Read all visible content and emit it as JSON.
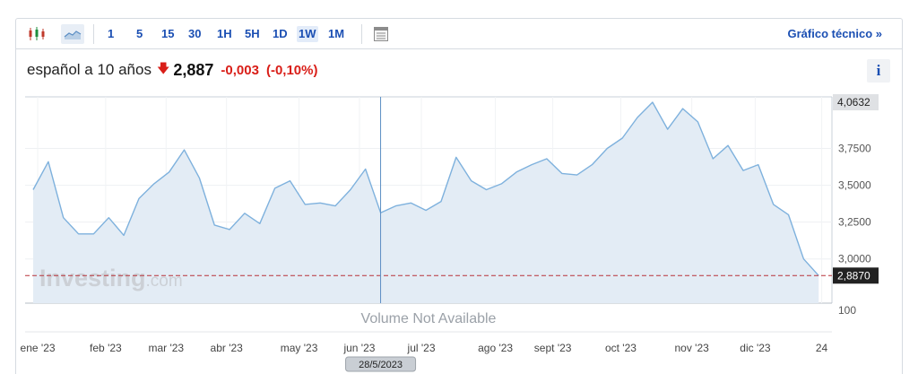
{
  "toolbar": {
    "intervals": [
      "1",
      "5",
      "15",
      "30",
      "1H",
      "5H",
      "1D",
      "1W",
      "1M"
    ],
    "active_interval": "1W",
    "technical_link": "Gráfico técnico »"
  },
  "quote": {
    "name": "español a 10 años",
    "direction": "down",
    "price": "2,887",
    "change": "-0,003",
    "change_pct": "(-0,10%)",
    "negative_color": "#d91e18"
  },
  "info_label": "i",
  "watermark": {
    "brand": "Investing",
    "suffix": ".com"
  },
  "volume_text": "Volume Not Available",
  "volume_axis_label": "100",
  "crosshair_date": "28/5/2023",
  "chart_data": {
    "type": "area",
    "color": "#7eb1dd",
    "fill": "#e3ecf5",
    "last_value": 2.887,
    "last_value_label": "2,8870",
    "max_value": 4.0632,
    "max_value_label": "4,0632",
    "crosshair_value": 3.313,
    "ylim": [
      2.7,
      4.1
    ],
    "y_ticks": [
      3.0,
      3.25,
      3.5,
      3.75
    ],
    "y_tick_labels": [
      "3,0000",
      "3,2500",
      "3,5000",
      "3,7500"
    ],
    "x_tick_labels": [
      "ene '23",
      "feb '23",
      "mar '23",
      "abr '23",
      "may '23",
      "jun '23",
      "jul '23",
      "ago '23",
      "sept '23",
      "oct '23",
      "nov '23",
      "dic '23",
      "24"
    ],
    "x_tick_index": [
      0.3,
      4.8,
      8.8,
      12.8,
      17.6,
      21.6,
      25.7,
      30.6,
      34.4,
      38.9,
      43.6,
      47.8,
      52.2
    ],
    "values": [
      3.47,
      3.66,
      3.28,
      3.17,
      3.17,
      3.28,
      3.16,
      3.41,
      3.51,
      3.59,
      3.74,
      3.55,
      3.23,
      3.2,
      3.31,
      3.24,
      3.48,
      3.53,
      3.37,
      3.38,
      3.36,
      3.47,
      3.61,
      3.313,
      3.36,
      3.38,
      3.33,
      3.39,
      3.69,
      3.53,
      3.47,
      3.51,
      3.59,
      3.64,
      3.68,
      3.58,
      3.57,
      3.64,
      3.75,
      3.82,
      3.96,
      4.0632,
      3.88,
      4.02,
      3.93,
      3.68,
      3.77,
      3.6,
      3.64,
      3.37,
      3.3,
      3.0,
      2.887
    ]
  }
}
